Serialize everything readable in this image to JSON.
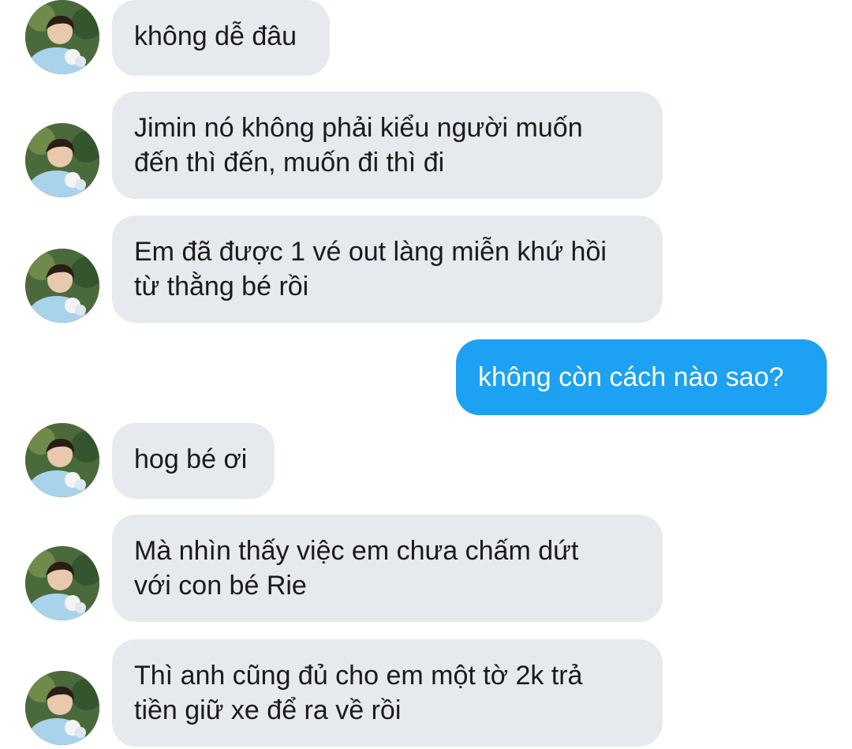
{
  "conversation": {
    "messages": [
      {
        "side": "left",
        "text": "không dễ đâu"
      },
      {
        "side": "left",
        "text": "Jimin nó không phải kiểu người muốn\nđến thì đến, muốn đi thì đi"
      },
      {
        "side": "left",
        "text": "Em đã được 1 vé out làng miễn khứ hồi\ntừ thằng bé rồi"
      },
      {
        "side": "right",
        "text": "không còn cách nào sao?"
      },
      {
        "side": "left",
        "text": "hog bé ơi"
      },
      {
        "side": "left",
        "text": "Mà nhìn thấy việc em chưa chấm dứt\nvới con bé Rie"
      },
      {
        "side": "left",
        "text": "Thì anh cũng đủ cho em một tờ 2k trả\ntiền giữ xe để ra về rồi"
      }
    ]
  },
  "colors": {
    "incoming_bubble": "#e6eaee",
    "outgoing_bubble": "#1da1f2",
    "incoming_text": "#1a1a1a",
    "outgoing_text": "#ffffff"
  },
  "icons": {
    "avatar": "contact-avatar-photo"
  }
}
